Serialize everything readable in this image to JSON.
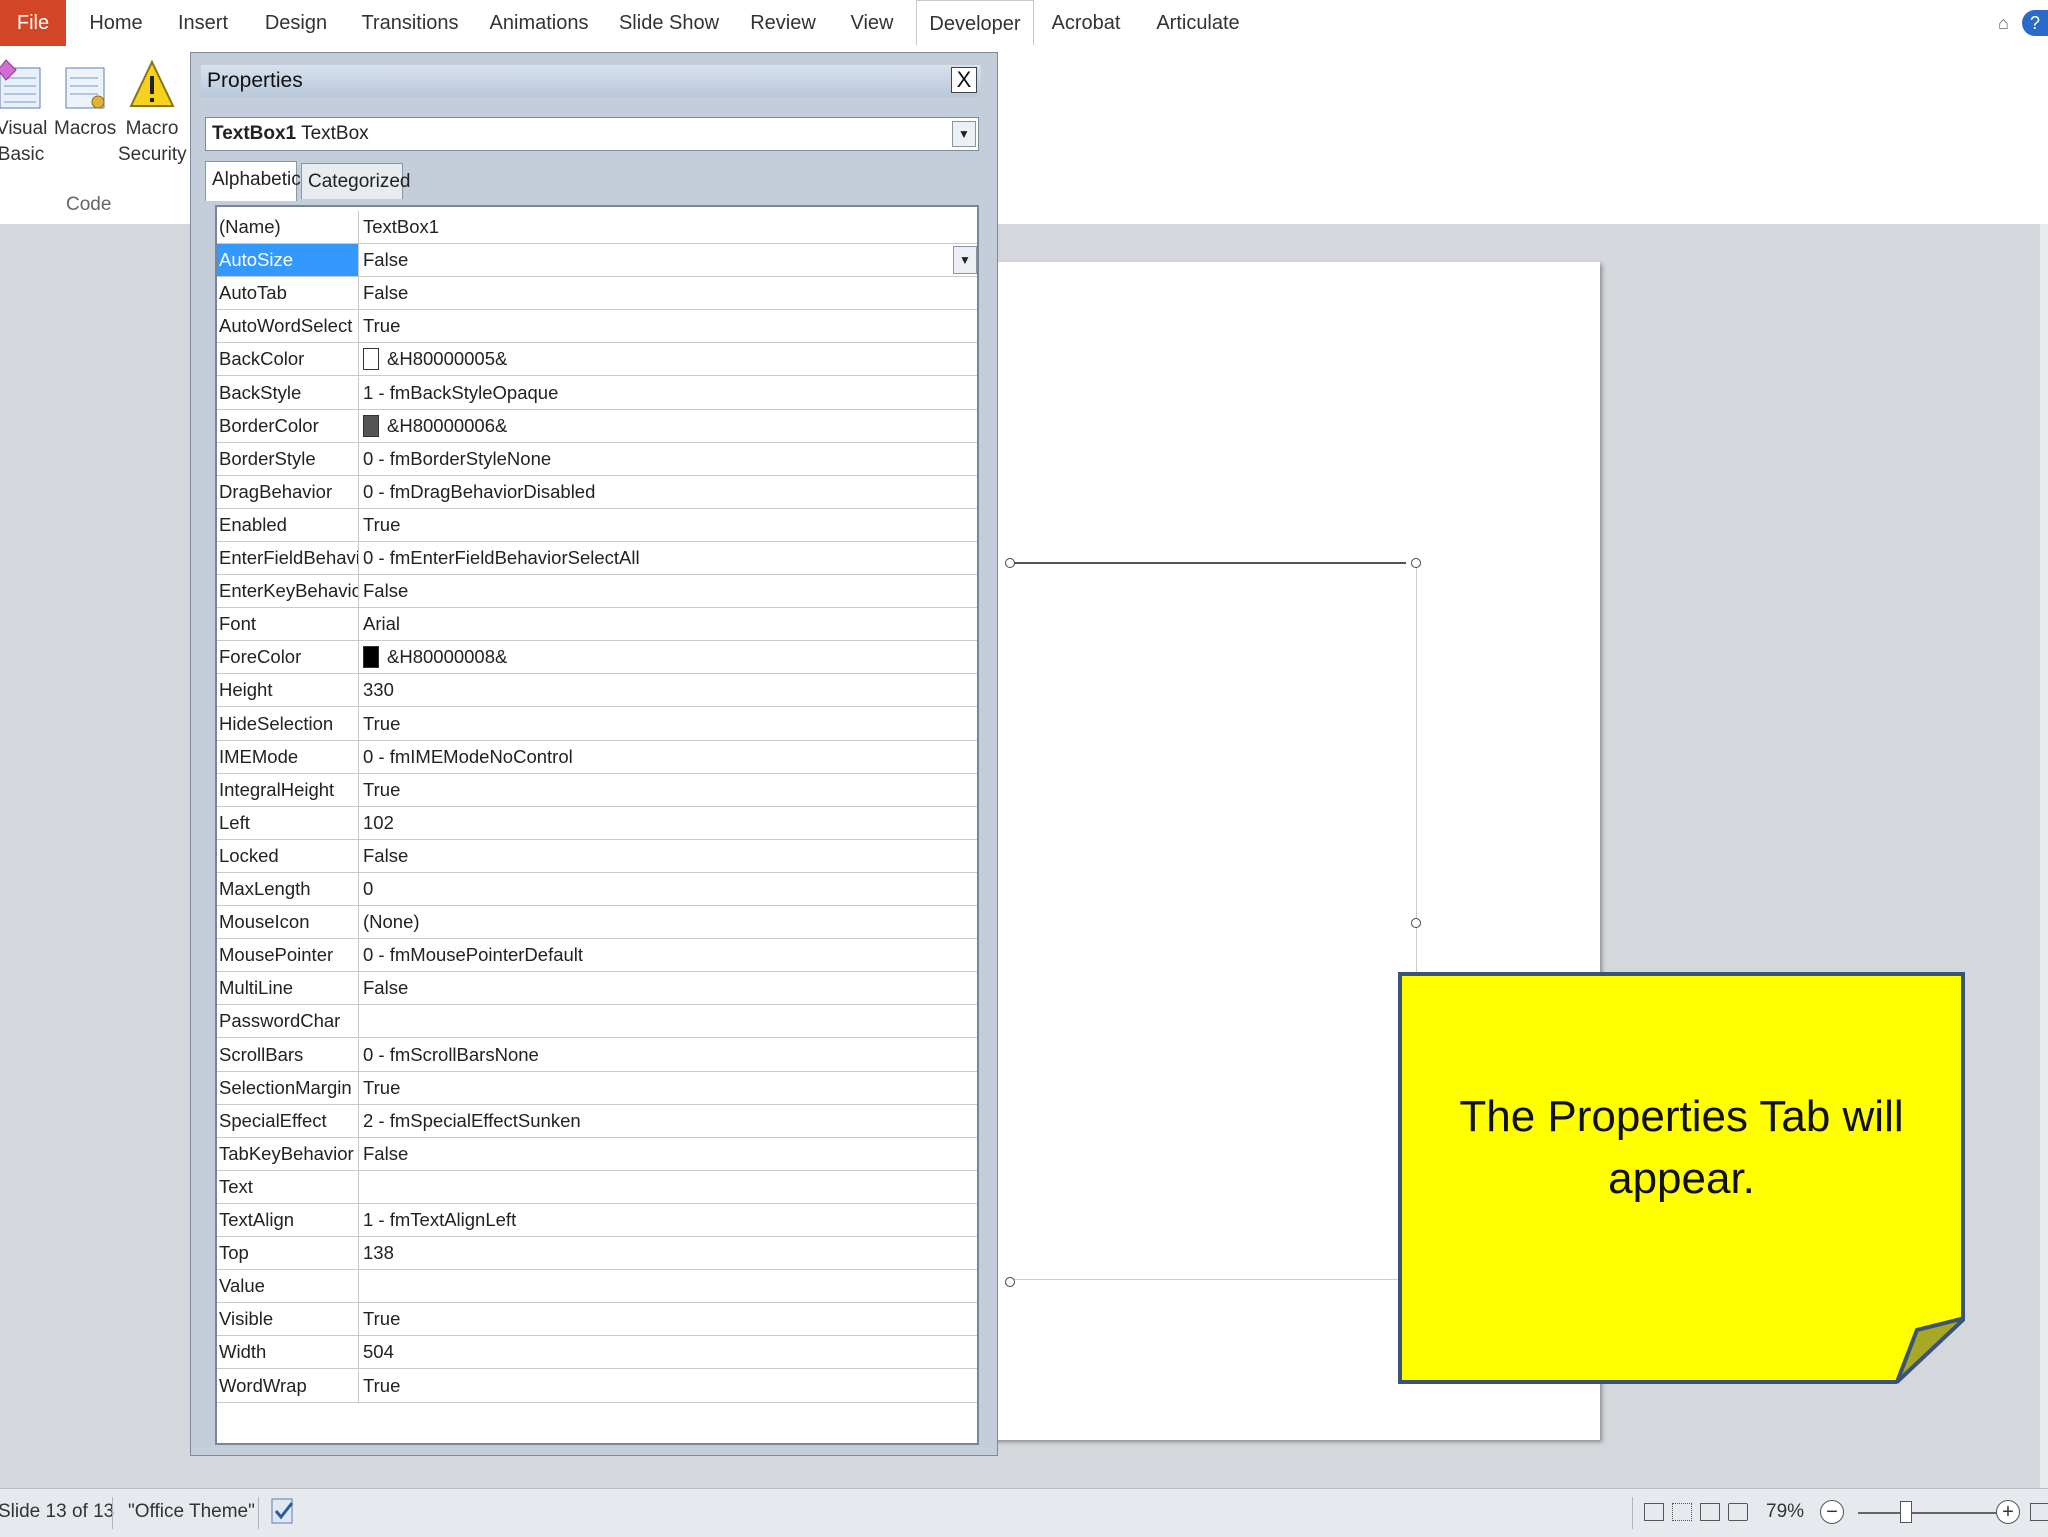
{
  "ribbon_tabs": [
    "File",
    "Home",
    "Insert",
    "Design",
    "Transitions",
    "Animations",
    "Slide Show",
    "Review",
    "View",
    "Developer",
    "Acrobat",
    "Articulate"
  ],
  "ribbon": {
    "buttons": [
      {
        "line1": "Visual",
        "line2": "Basic"
      },
      {
        "line1": "Macros",
        "line2": ""
      },
      {
        "line1": "Macro",
        "line2": "Security"
      }
    ],
    "group_label": "Code"
  },
  "properties": {
    "title": "Properties",
    "close": "X",
    "object_name": "TextBox1",
    "object_type": "TextBox",
    "tabs": [
      "Alphabetic",
      "Categorized"
    ],
    "rows": [
      {
        "k": "(Name)",
        "v": "TextBox1"
      },
      {
        "k": "AutoSize",
        "v": "False"
      },
      {
        "k": "AutoTab",
        "v": "False"
      },
      {
        "k": "AutoWordSelect",
        "v": "True"
      },
      {
        "k": "BackColor",
        "v": "&H80000005&",
        "swatch": "#ffffff"
      },
      {
        "k": "BackStyle",
        "v": "1 - fmBackStyleOpaque"
      },
      {
        "k": "BorderColor",
        "v": "&H80000006&",
        "swatch": "#555555"
      },
      {
        "k": "BorderStyle",
        "v": "0 - fmBorderStyleNone"
      },
      {
        "k": "DragBehavior",
        "v": "0 - fmDragBehaviorDisabled"
      },
      {
        "k": "Enabled",
        "v": "True"
      },
      {
        "k": "EnterFieldBehavior",
        "v": "0 - fmEnterFieldBehaviorSelectAll"
      },
      {
        "k": "EnterKeyBehavior",
        "v": "False"
      },
      {
        "k": "Font",
        "v": "Arial"
      },
      {
        "k": "ForeColor",
        "v": "&H80000008&",
        "swatch": "#000000"
      },
      {
        "k": "Height",
        "v": "330"
      },
      {
        "k": "HideSelection",
        "v": "True"
      },
      {
        "k": "IMEMode",
        "v": "0 - fmIMEModeNoControl"
      },
      {
        "k": "IntegralHeight",
        "v": "True"
      },
      {
        "k": "Left",
        "v": "102"
      },
      {
        "k": "Locked",
        "v": "False"
      },
      {
        "k": "MaxLength",
        "v": "0"
      },
      {
        "k": "MouseIcon",
        "v": "(None)"
      },
      {
        "k": "MousePointer",
        "v": "0 - fmMousePointerDefault"
      },
      {
        "k": "MultiLine",
        "v": "False"
      },
      {
        "k": "PasswordChar",
        "v": ""
      },
      {
        "k": "ScrollBars",
        "v": "0 - fmScrollBarsNone"
      },
      {
        "k": "SelectionMargin",
        "v": "True"
      },
      {
        "k": "SpecialEffect",
        "v": "2 - fmSpecialEffectSunken"
      },
      {
        "k": "TabKeyBehavior",
        "v": "False"
      },
      {
        "k": "Text",
        "v": ""
      },
      {
        "k": "TextAlign",
        "v": "1 - fmTextAlignLeft"
      },
      {
        "k": "Top",
        "v": "138"
      },
      {
        "k": "Value",
        "v": ""
      },
      {
        "k": "Visible",
        "v": "True"
      },
      {
        "k": "Width",
        "v": "504"
      },
      {
        "k": "WordWrap",
        "v": "True"
      }
    ],
    "selected_row": "AutoSize"
  },
  "callout": {
    "text": "The Properties Tab will appear."
  },
  "status": {
    "slide": "Slide 13 of 13",
    "theme": "\"Office Theme\"",
    "zoom": "79%"
  },
  "colors": {
    "file_tab": "#d24625",
    "callout_fill": "#ffff00",
    "callout_border": "#3b5377",
    "selection": "#3399ff"
  }
}
